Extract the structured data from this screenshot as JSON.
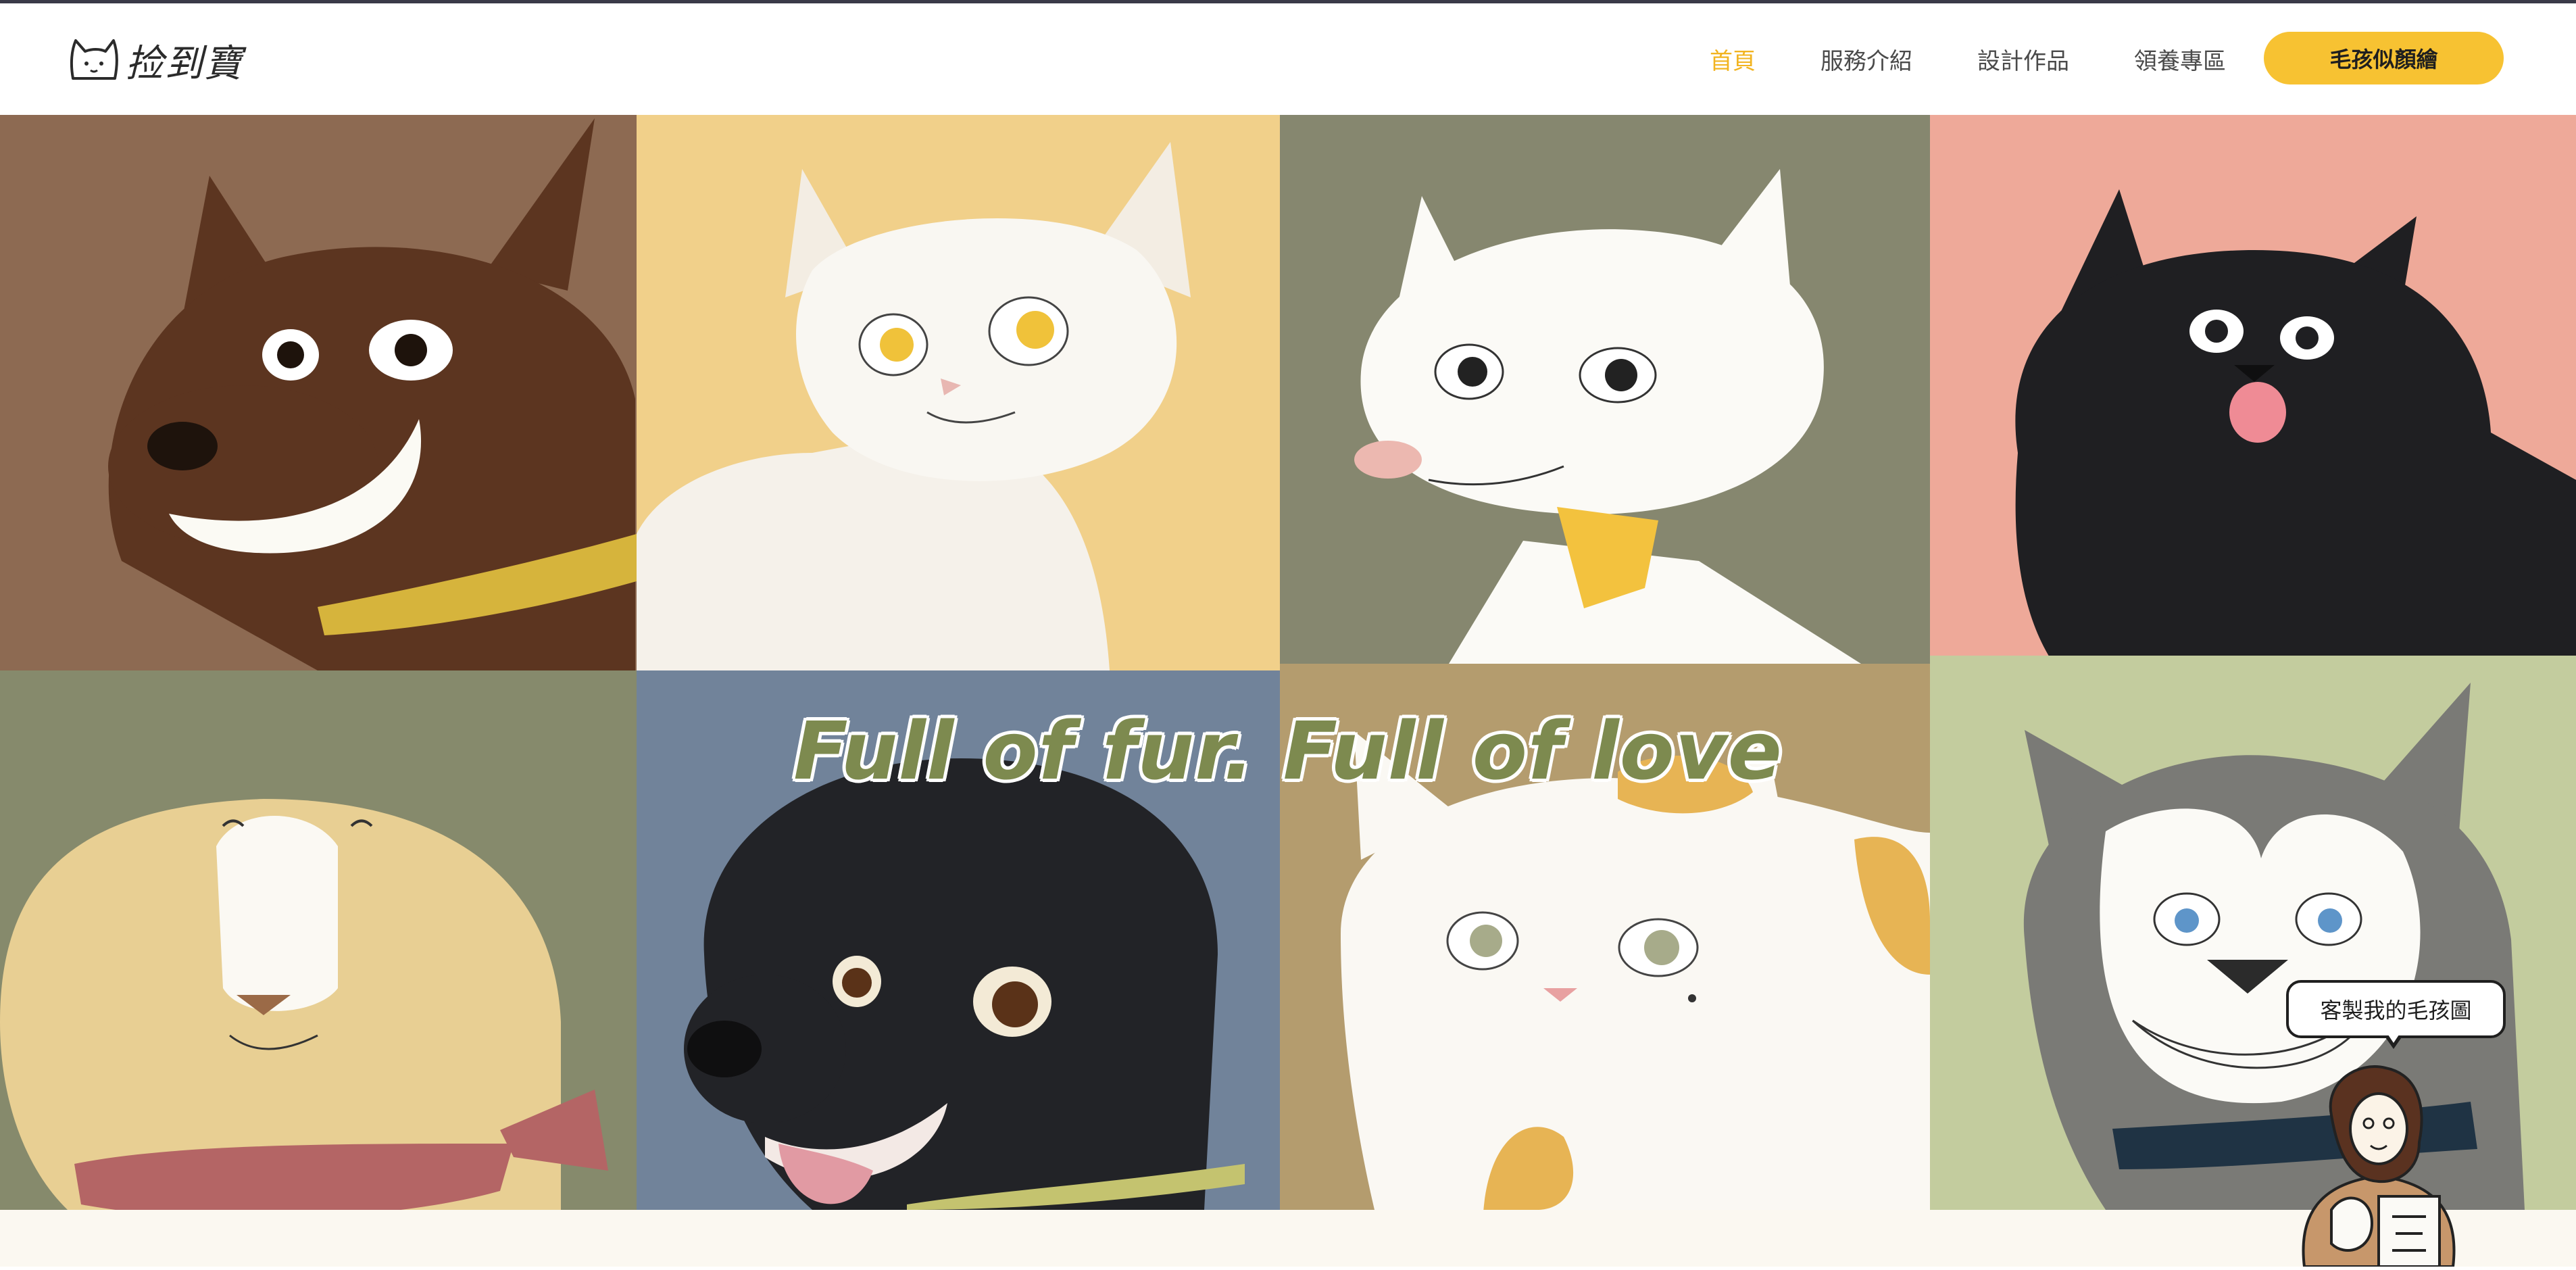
{
  "brand": {
    "logo_text": "捡到寶",
    "logo_icon": "cat-face-logo-icon"
  },
  "nav": {
    "items": [
      {
        "label": "首頁",
        "active": true
      },
      {
        "label": "服務介紹",
        "active": false
      },
      {
        "label": "設計作品",
        "active": false
      },
      {
        "label": "領養專區",
        "active": false
      }
    ],
    "cta_label": "毛孩似顏繪"
  },
  "hero": {
    "tagline": "Full of fur. Full of love",
    "tiles": [
      {
        "animal": "brown-dog",
        "bg": "#8d6a52"
      },
      {
        "animal": "white-cat-yellow-eyes",
        "bg": "#f1d08a"
      },
      {
        "animal": "white-cat-collar",
        "bg": "#86876f"
      },
      {
        "animal": "black-fluffy-dog",
        "bg": "#eea999"
      },
      {
        "animal": "golden-dog-bandana",
        "bg": "#868a6c"
      },
      {
        "animal": "black-lab",
        "bg": "#71839a"
      },
      {
        "animal": "calico-cat",
        "bg": "#b49c6e"
      },
      {
        "animal": "husky",
        "bg": "#c3cc9e"
      }
    ]
  },
  "chat": {
    "bubble_text": "客製我的毛孩圖",
    "avatar_icon": "artist-avatar-icon"
  },
  "colors": {
    "accent": "#f7c232",
    "active_nav": "#f2b421",
    "tagline": "#7d8a4f"
  }
}
